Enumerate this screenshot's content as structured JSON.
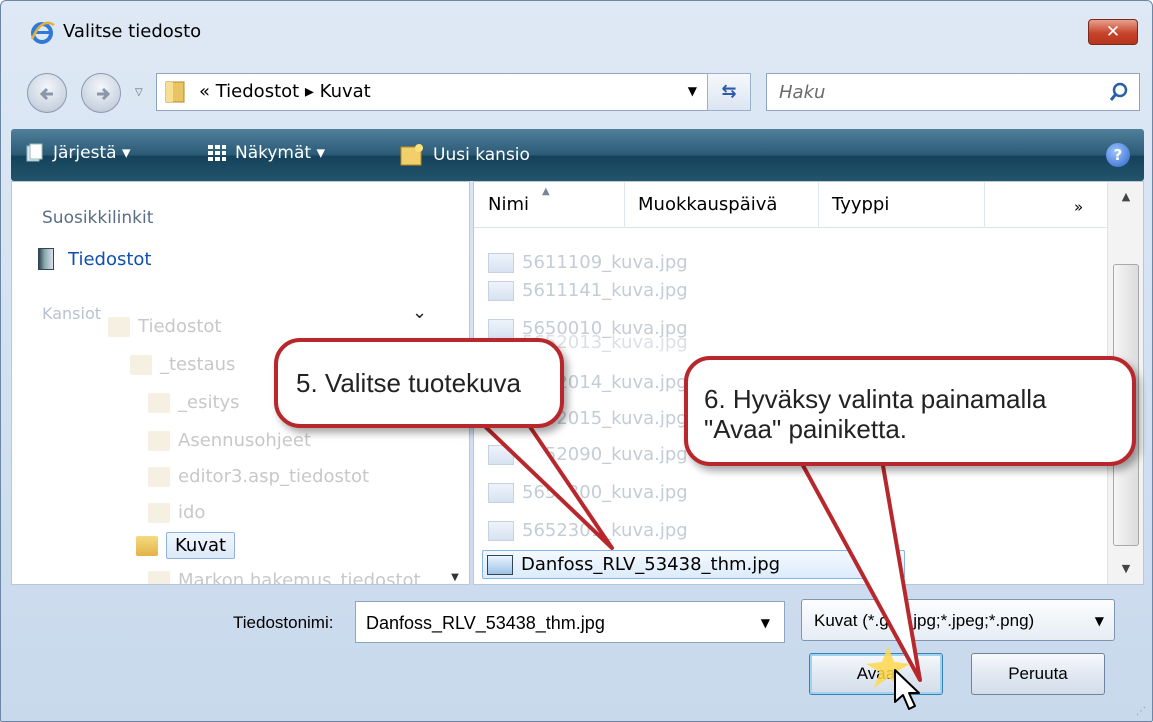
{
  "window": {
    "title": "Valitse tiedosto",
    "close_label": "✕"
  },
  "address": {
    "crumbs": "« Tiedostot ▸ Kuvat",
    "search_placeholder": "Haku"
  },
  "toolbar": {
    "organize": "Järjestä ▾",
    "views": "Näkymät ▾",
    "new_folder": "Uusi kansio",
    "help": "?"
  },
  "left_pane": {
    "favorites_title": "Suosikkilinkit",
    "favorites": [
      {
        "label": "Tiedostot"
      }
    ],
    "folders_title": "Kansiot",
    "tree": [
      {
        "label": "Tiedostot"
      },
      {
        "label": "_testaus"
      },
      {
        "label": "_esitys"
      },
      {
        "label": "Asennusohjeet"
      },
      {
        "label": "editor3.asp_tiedostot"
      },
      {
        "label": "ido"
      },
      {
        "label": "Kuvat",
        "selected": true
      },
      {
        "label": "Markon hakemus_tiedostot"
      }
    ]
  },
  "file_list": {
    "columns": [
      "Nimi",
      "Muokkauspäivä",
      "Tyyppi",
      "»"
    ],
    "files": [
      {
        "name": "5611109_kuva.jpg"
      },
      {
        "name": "5611141_kuva.jpg"
      },
      {
        "name": "5650010_kuva.jpg"
      },
      {
        "name": "5652013_kuva.jpg"
      },
      {
        "name": "5652014_kuva.jpg"
      },
      {
        "name": "5652015_kuva.jpg"
      },
      {
        "name": "5652090_kuva.jpg"
      },
      {
        "name": "5652300_kuva.jpg"
      },
      {
        "name": "5652301_kuva.jpg"
      },
      {
        "name": "Danfoss_RLV_53438_thm.jpg",
        "selected": true
      }
    ]
  },
  "bottom": {
    "filename_label": "Tiedostonimi:",
    "filename_value": "Danfoss_RLV_53438_thm.jpg",
    "filter_value": "Kuvat (*.gif;*.jpg;*.jpeg;*.png)",
    "open_label": "Avaa",
    "cancel_label": "Peruuta"
  },
  "annotations": {
    "step5": "5. Valitse tuotekuva",
    "step6_line1": "6. Hyväksy valinta painamalla",
    "step6_line2": "\"Avaa\" painiketta."
  },
  "colors": {
    "callout_border": "#b8272c",
    "toolbar": "#2a5a75",
    "link": "#0f4fb0"
  }
}
